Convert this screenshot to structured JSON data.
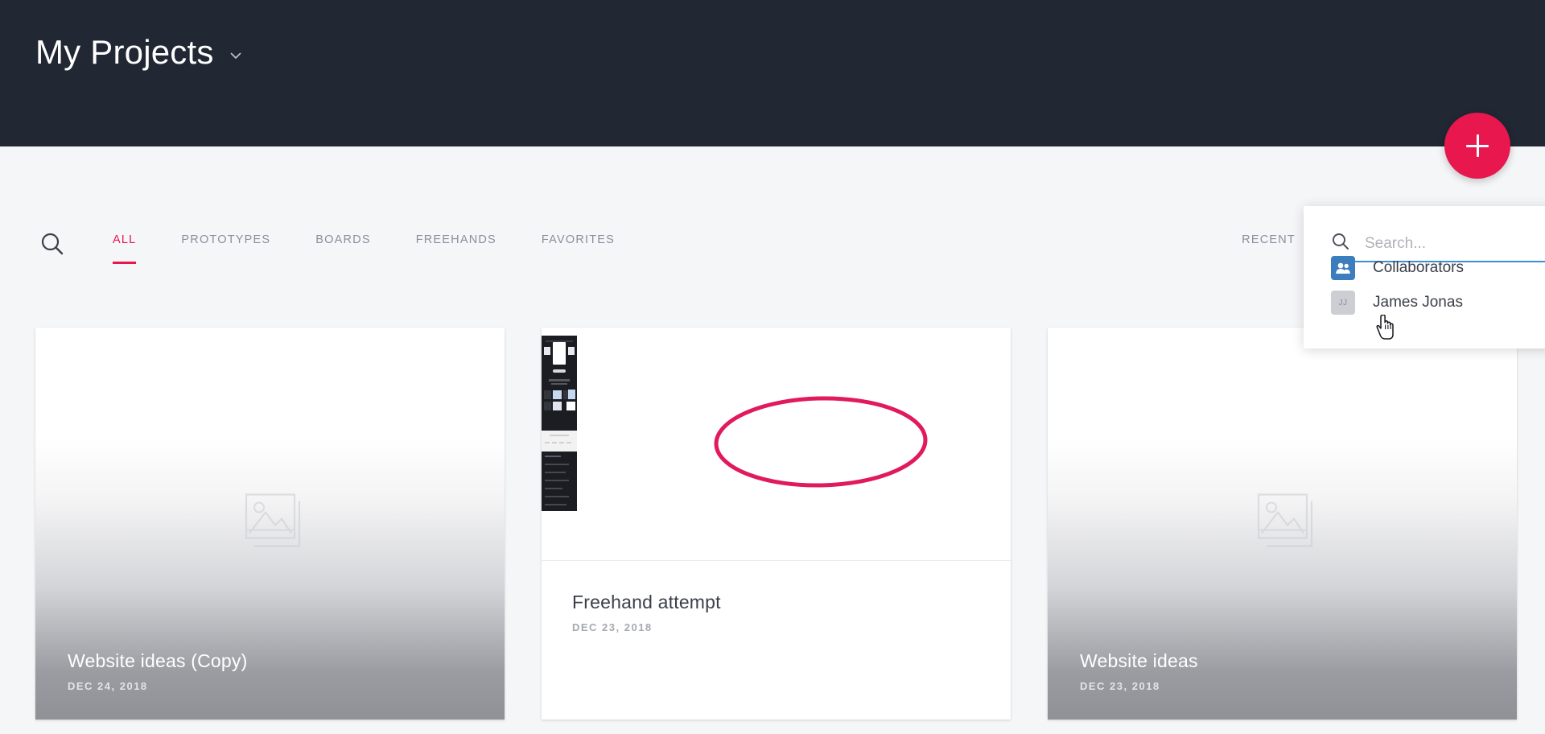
{
  "header": {
    "title": "My Projects",
    "chevron_icon": "chevron-down-icon",
    "background_color": "#212733"
  },
  "fab": {
    "label": "+",
    "icon": "plus-icon",
    "color": "#e8174e"
  },
  "toolbar": {
    "search_icon": "search-icon",
    "tabs": [
      {
        "label": "ALL",
        "active": true
      },
      {
        "label": "PROTOTYPES",
        "active": false
      },
      {
        "label": "BOARDS",
        "active": false
      },
      {
        "label": "FREEHANDS",
        "active": false
      },
      {
        "label": "FAVORITES",
        "active": false
      }
    ],
    "sort": {
      "label": "RECENT",
      "icon": "triangle-down-icon"
    },
    "active_color": "#e8174e",
    "inactive_color": "#8b8f9c"
  },
  "cards": [
    {
      "title": "Website ideas (Copy)",
      "date": "DEC 24, 2018",
      "style": "gradient-overlay",
      "thumb_icon": "image-placeholder-icon"
    },
    {
      "title": "Freehand attempt",
      "date": "DEC 23, 2018",
      "style": "white-footer",
      "thumb_icon": "freehand-thumbnail",
      "annotation": "pink-ellipse"
    },
    {
      "title": "Website ideas",
      "date": "DEC 23, 2018",
      "style": "gradient-overlay",
      "thumb_icon": "image-placeholder-icon"
    }
  ],
  "dropdown": {
    "search_icon": "search-icon",
    "search_value": "",
    "search_placeholder": "Search...",
    "underline_color": "#3b8fd4",
    "items": [
      {
        "label": "Collaborators",
        "avatar_icon": "people-icon",
        "avatar_initials": "",
        "avatar_color": "#3b7dbd"
      },
      {
        "label": "James Jonas",
        "avatar_icon": "initials-avatar",
        "avatar_initials": "JJ",
        "avatar_color": "#ccced3"
      }
    ]
  },
  "cursor": {
    "type": "pointing-hand-cursor"
  }
}
